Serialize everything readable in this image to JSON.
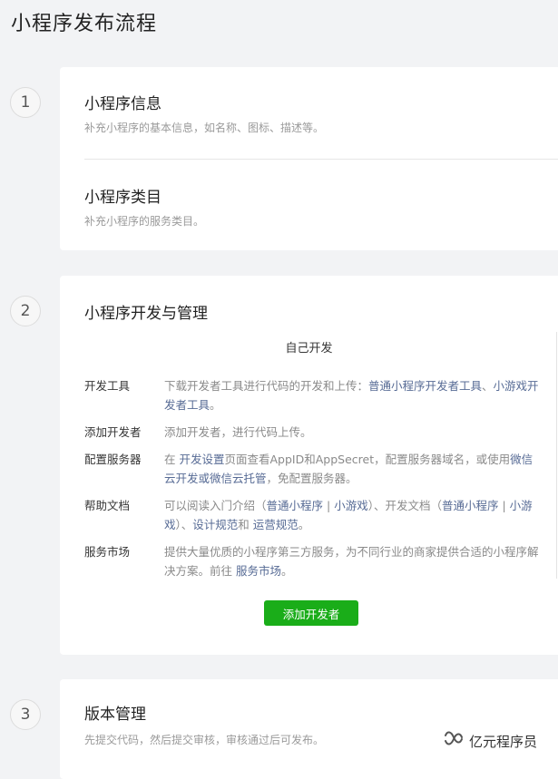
{
  "page_title": "小程序发布流程",
  "steps": [
    {
      "number": "1",
      "sections": [
        {
          "title": "小程序信息",
          "desc": "补充小程序的基本信息，如名称、图标、描述等。"
        },
        {
          "title": "小程序类目",
          "desc": "补充小程序的服务类目。"
        }
      ]
    },
    {
      "number": "2",
      "title": "小程序开发与管理",
      "self_dev_label": "自己开发",
      "rows": {
        "dev_tools": {
          "label": "开发工具",
          "text1": "下载开发者工具进行代码的开发和上传：",
          "link1": "普通小程序开发者工具",
          "text2": "、",
          "link2": "小游戏开发者工具",
          "text3": "。"
        },
        "add_dev": {
          "label": "添加开发者",
          "text1": "添加开发者，进行代码上传。"
        },
        "server": {
          "label": "配置服务器",
          "text1": "在 ",
          "link1": "开发设置",
          "text2": "页面查看AppID和AppSecret，配置服务器域名，或使用",
          "link2": "微信云开发或微信云托管",
          "text3": "，免配置服务器。"
        },
        "docs": {
          "label": "帮助文档",
          "text1": "可以阅读入门介绍（",
          "link1": "普通小程序",
          "sep1": " | ",
          "link2": "小游戏",
          "text2": "）、开发文档（",
          "link3": "普通小程序",
          "sep2": " | ",
          "link4": "小游戏",
          "text3": "）、",
          "link5": "设计规范",
          "text4": "和 ",
          "link6": "运营规范",
          "text5": "。"
        },
        "market": {
          "label": "服务市场",
          "text1": "提供大量优质的小程序第三方服务，为不同行业的商家提供合适的小程序解决方案。前往 ",
          "link1": "服务市场",
          "text2": "。"
        }
      },
      "button_label": "添加开发者"
    },
    {
      "number": "3",
      "title": "版本管理",
      "desc": "先提交代码，然后提交审核，审核通过后可发布。"
    }
  ],
  "watermark": {
    "icon": "wechat-channel-icon",
    "text": "亿元程序员"
  },
  "colors": {
    "link": "#576b95",
    "button": "#1aad19",
    "background": "#f2f3f5"
  }
}
